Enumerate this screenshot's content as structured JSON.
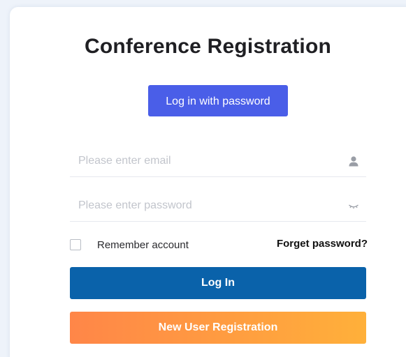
{
  "title": "Conference Registration",
  "login_tab": {
    "label": "Log in with password",
    "color": "#4a5ee8"
  },
  "email_field": {
    "value": "",
    "placeholder": "Please enter email",
    "icon": "user-icon"
  },
  "password_field": {
    "value": "",
    "placeholder": "Please enter password",
    "icon": "eye-closed-icon"
  },
  "remember": {
    "label": "Remember account",
    "checked": false
  },
  "forget_link": "Forget password?",
  "login_button": {
    "label": "Log In",
    "color": "#0a62aa"
  },
  "register_button": {
    "label": "New User Registration",
    "gradient": [
      "#ff8648",
      "#ffb03a"
    ]
  }
}
